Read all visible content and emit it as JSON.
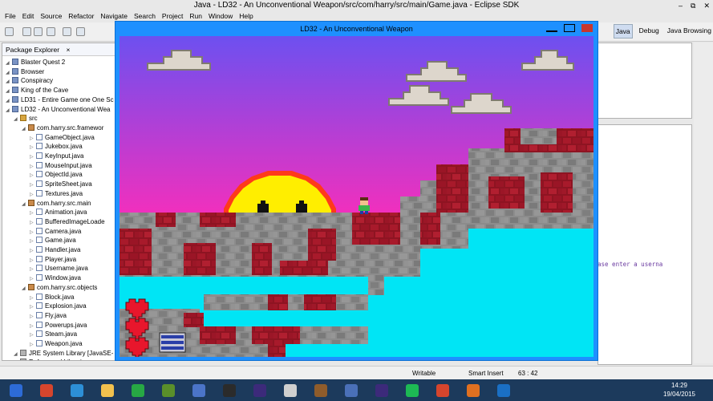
{
  "eclipse": {
    "title": "Java - LD32 - An Unconventional Weapon/src/com/harry/src/main/Game.java - Eclipse SDK",
    "menu": [
      "File",
      "Edit",
      "Source",
      "Refactor",
      "Navigate",
      "Search",
      "Project",
      "Run",
      "Window",
      "Help"
    ],
    "perspectives": [
      "Java",
      "Debug",
      "Java Browsing"
    ],
    "package_explorer": {
      "title": "Package Explorer",
      "tree": [
        {
          "label": "Blaster Quest 2",
          "icon": "project-icon",
          "depth": 0
        },
        {
          "label": "Browser",
          "icon": "project-icon",
          "depth": 0
        },
        {
          "label": "Conspiracy",
          "icon": "project-icon",
          "depth": 0
        },
        {
          "label": "King of the Cave",
          "icon": "project-icon",
          "depth": 0
        },
        {
          "label": "LD31 - Entire Game one One Sc",
          "icon": "project-icon",
          "depth": 0
        },
        {
          "label": "LD32 - An Unconventional Wea",
          "icon": "project-icon",
          "depth": 0
        },
        {
          "label": "src",
          "icon": "source-folder-icon",
          "depth": 1
        },
        {
          "label": "com.harry.src.framewor",
          "icon": "package-icon",
          "depth": 2
        },
        {
          "label": "GameObject.java",
          "icon": "java-file-icon",
          "depth": 3
        },
        {
          "label": "Jukebox.java",
          "icon": "java-file-icon",
          "depth": 3
        },
        {
          "label": "KeyInput.java",
          "icon": "java-file-icon",
          "depth": 3
        },
        {
          "label": "MouseInput.java",
          "icon": "java-file-icon",
          "depth": 3
        },
        {
          "label": "ObjectId.java",
          "icon": "java-file-icon",
          "depth": 3
        },
        {
          "label": "SpriteSheet.java",
          "icon": "java-file-icon",
          "depth": 3
        },
        {
          "label": "Textures.java",
          "icon": "java-file-icon",
          "depth": 3
        },
        {
          "label": "com.harry.src.main",
          "icon": "package-icon",
          "depth": 2
        },
        {
          "label": "Animation.java",
          "icon": "java-file-icon",
          "depth": 3
        },
        {
          "label": "BufferedImageLoade",
          "icon": "java-file-icon",
          "depth": 3
        },
        {
          "label": "Camera.java",
          "icon": "java-file-icon",
          "depth": 3
        },
        {
          "label": "Game.java",
          "icon": "java-file-icon",
          "depth": 3
        },
        {
          "label": "Handler.java",
          "icon": "java-file-icon",
          "depth": 3
        },
        {
          "label": "Player.java",
          "icon": "java-file-icon",
          "depth": 3
        },
        {
          "label": "Username.java",
          "icon": "java-file-icon",
          "depth": 3
        },
        {
          "label": "Window.java",
          "icon": "java-file-icon",
          "depth": 3
        },
        {
          "label": "com.harry.src.objects",
          "icon": "package-icon",
          "depth": 2
        },
        {
          "label": "Block.java",
          "icon": "java-file-icon",
          "depth": 3
        },
        {
          "label": "Explosion.java",
          "icon": "java-file-icon",
          "depth": 3
        },
        {
          "label": "Fly.java",
          "icon": "java-file-icon",
          "depth": 3
        },
        {
          "label": "Powerups.java",
          "icon": "java-file-icon",
          "depth": 3
        },
        {
          "label": "Steam.java",
          "icon": "java-file-icon",
          "depth": 3
        },
        {
          "label": "Weapon.java",
          "icon": "java-file-icon",
          "depth": 3
        },
        {
          "label": "JRE System Library [JavaSE-",
          "icon": "library-icon",
          "depth": 1
        },
        {
          "label": "Referenced Libraries",
          "icon": "library-icon",
          "depth": 1
        }
      ]
    },
    "console_text": "ase enter a userna",
    "status": {
      "writable": "Writable",
      "insert_mode": "Smart Insert",
      "position": "63 : 42"
    }
  },
  "game": {
    "title": "LD32 - An Unconventional Weapon",
    "colors": {
      "sky_top": "#6d50f0",
      "sky_bottom": "#ff2cb8",
      "water": "#00e5f5",
      "brick_red": "#a8152a",
      "stone": "#8c8c8c",
      "sun": "#ffee00",
      "sun_outline": "#ff3a1a",
      "frame": "#1e90ff"
    },
    "hearts": 3
  },
  "taskbar": {
    "apps": [
      "start-icon",
      "chrome-icon",
      "ie-icon",
      "file-explorer-icon",
      "store-icon",
      "minecraft-icon",
      "paint-icon",
      "steam-icon",
      "eclipse-icon",
      "eye-icon",
      "hammer-icon",
      "photo-icon",
      "eclipse-icon-2",
      "spotify-icon",
      "flag-icon",
      "java-icon",
      "outlook-icon"
    ],
    "time": "14:29",
    "date": "19/04/2015"
  }
}
